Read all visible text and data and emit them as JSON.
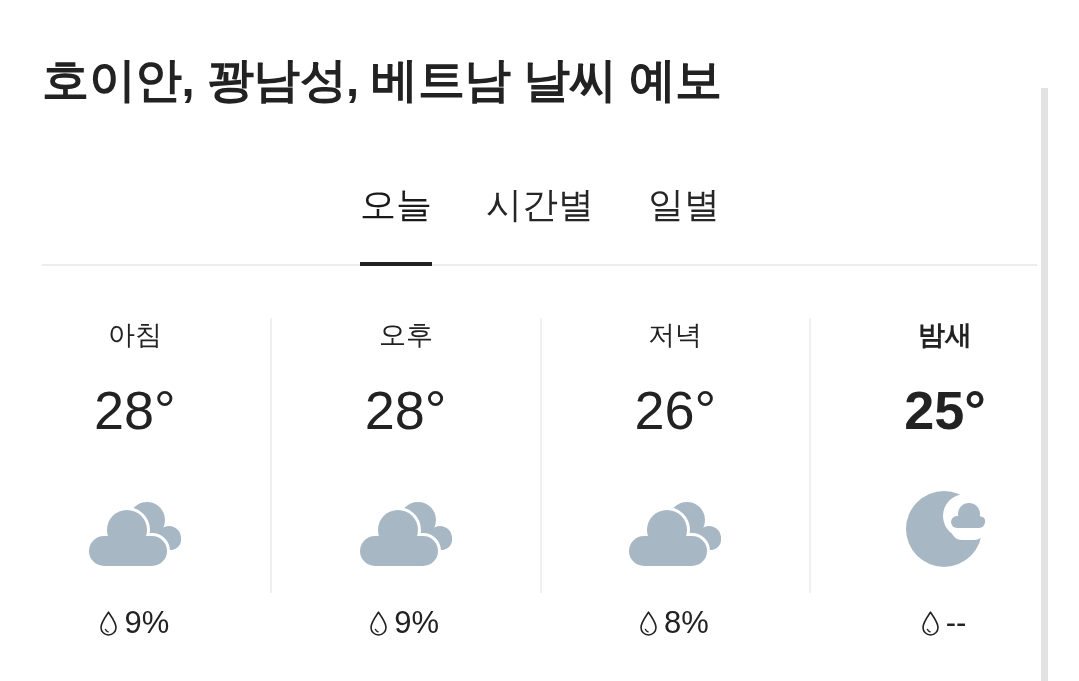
{
  "title": "호이안, 꽝남성, 베트남 날씨 예보",
  "tabs": [
    {
      "label": "오늘",
      "selected": true
    },
    {
      "label": "시간별",
      "selected": false
    },
    {
      "label": "일별",
      "selected": false
    }
  ],
  "periods": [
    {
      "label": "아침",
      "temperature": "28°",
      "kind": "partly-cloudy",
      "precipitation": "9%",
      "current": false
    },
    {
      "label": "오후",
      "temperature": "28°",
      "kind": "partly-cloudy",
      "precipitation": "9%",
      "current": false
    },
    {
      "label": "저녁",
      "temperature": "26°",
      "kind": "partly-cloudy",
      "precipitation": "8%",
      "current": false
    },
    {
      "label": "밤새",
      "temperature": "25°",
      "kind": "night-cloudy",
      "precipitation": "--",
      "current": true
    }
  ]
}
